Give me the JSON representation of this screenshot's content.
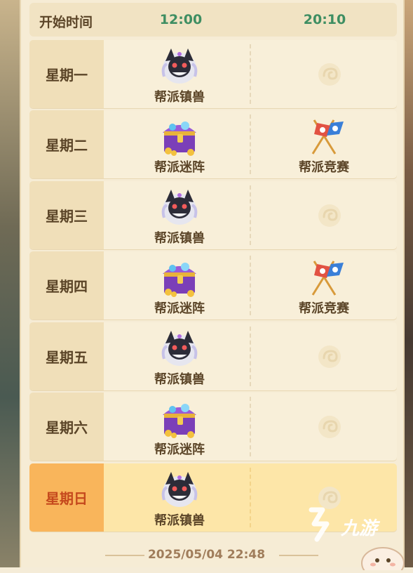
{
  "header": {
    "label": "开始时间",
    "col1": "12:00",
    "col2": "20:10"
  },
  "rows": [
    {
      "day": "星期一",
      "slot1": {
        "label": "帮派镇兽",
        "icon": "beast-icon"
      },
      "slot2": {
        "label": "",
        "icon": "empty-cloud-icon"
      }
    },
    {
      "day": "星期二",
      "slot1": {
        "label": "帮派迷阵",
        "icon": "treasure-chest-icon"
      },
      "slot2": {
        "label": "帮派竞赛",
        "icon": "crossed-flags-icon"
      }
    },
    {
      "day": "星期三",
      "slot1": {
        "label": "帮派镇兽",
        "icon": "beast-icon"
      },
      "slot2": {
        "label": "",
        "icon": "empty-cloud-icon"
      }
    },
    {
      "day": "星期四",
      "slot1": {
        "label": "帮派迷阵",
        "icon": "treasure-chest-icon"
      },
      "slot2": {
        "label": "帮派竞赛",
        "icon": "crossed-flags-icon"
      }
    },
    {
      "day": "星期五",
      "slot1": {
        "label": "帮派镇兽",
        "icon": "beast-icon"
      },
      "slot2": {
        "label": "",
        "icon": "empty-cloud-icon"
      }
    },
    {
      "day": "星期六",
      "slot1": {
        "label": "帮派迷阵",
        "icon": "treasure-chest-icon"
      },
      "slot2": {
        "label": "",
        "icon": "empty-cloud-icon"
      }
    },
    {
      "day": "星期日",
      "slot1": {
        "label": "帮派镇兽",
        "icon": "beast-icon"
      },
      "slot2": {
        "label": "",
        "icon": "empty-cloud-icon"
      },
      "highlighted": true
    }
  ],
  "footer": {
    "datetime": "2025/05/04    22:48"
  },
  "watermark": {
    "text": "九游"
  },
  "colors": {
    "time_header": "#3e8e62",
    "day_text": "#5b4528",
    "sunday_bg": "#f9b55b",
    "sunday_text": "#c5491d"
  }
}
